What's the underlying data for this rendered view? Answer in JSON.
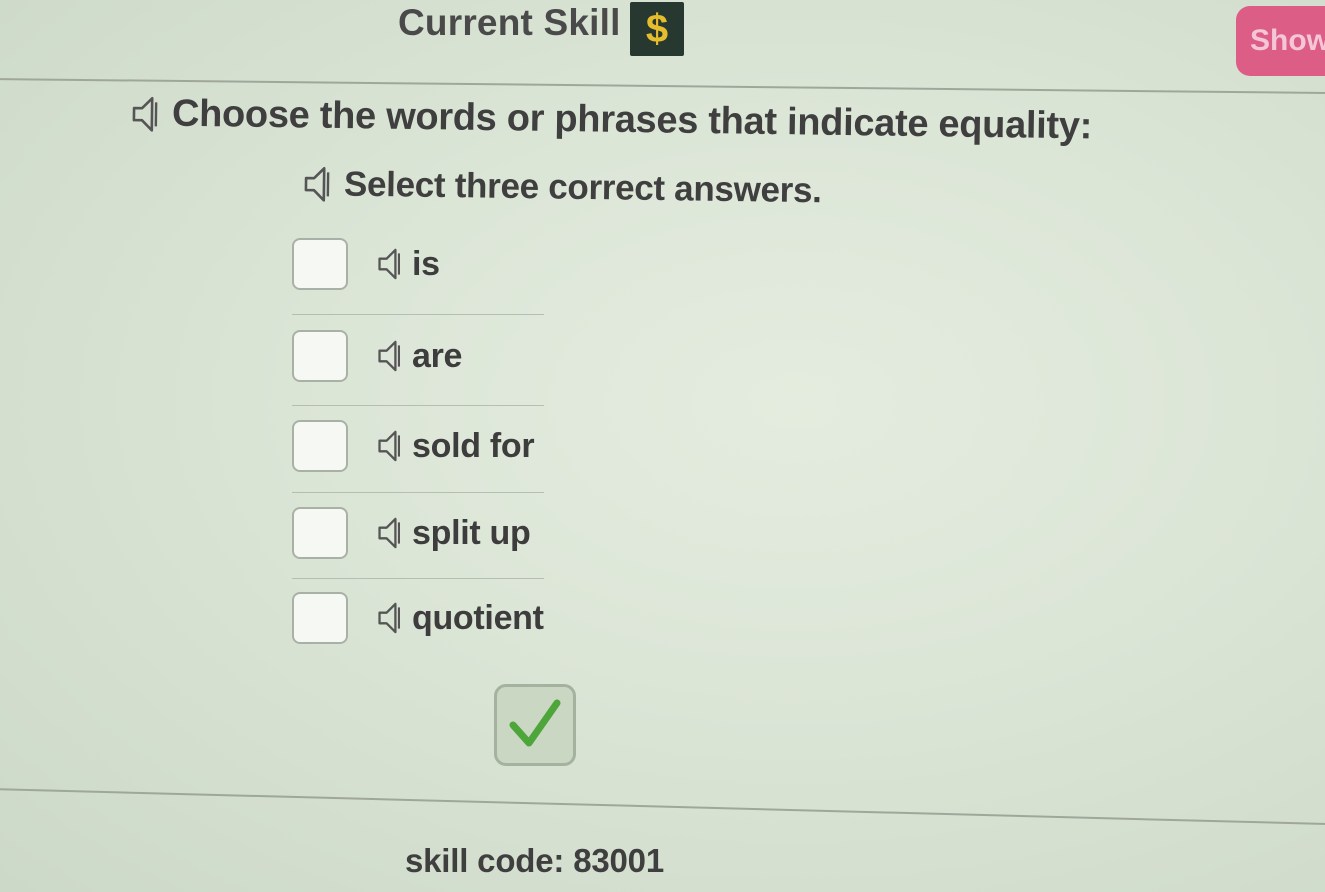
{
  "header": {
    "title": "Current Skill",
    "badge_symbol": "$",
    "show_label": "Show"
  },
  "question": {
    "prompt": "Choose the words or phrases that indicate equality:",
    "instruction": "Select three correct answers."
  },
  "options": [
    {
      "label": "is",
      "checked": false
    },
    {
      "label": "are",
      "checked": false
    },
    {
      "label": "sold for",
      "checked": false
    },
    {
      "label": "split up",
      "checked": false
    },
    {
      "label": "quotient",
      "checked": false
    }
  ],
  "submit": {
    "icon": "checkmark-icon"
  },
  "footer": {
    "skill_code_label": "skill code:",
    "skill_code_value": "83001"
  },
  "colors": {
    "background": "#dbe5d6",
    "show_button": "#dc5d86",
    "badge_background": "#263830",
    "badge_symbol": "#e6bd2c",
    "checkmark": "#4ea53a"
  }
}
